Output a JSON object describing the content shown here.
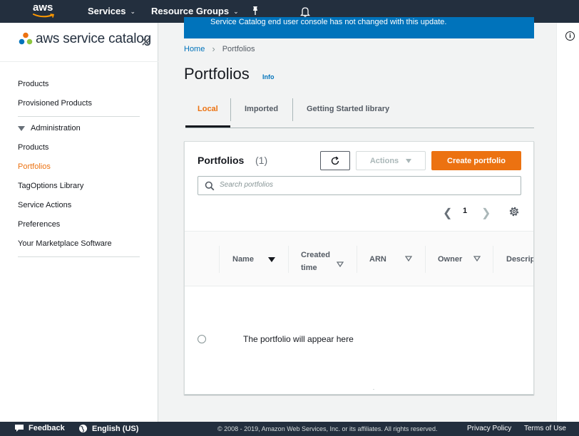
{
  "topnav": {
    "logo_text": "aws",
    "services_label": "Services",
    "resource_groups_label": "Resource Groups"
  },
  "banner": {
    "text": "Service Catalog end user console has not changed with this update."
  },
  "sidebar": {
    "brand": "aws service catalog",
    "items_top": [
      {
        "label": "Products"
      },
      {
        "label": "Provisioned Products"
      }
    ],
    "admin_label": "Administration",
    "items_admin": [
      {
        "label": "Products",
        "active": false
      },
      {
        "label": "Portfolios",
        "active": true
      },
      {
        "label": "TagOptions Library",
        "active": false
      },
      {
        "label": "Service Actions",
        "active": false
      },
      {
        "label": "Preferences",
        "active": false
      },
      {
        "label": "Your Marketplace Software",
        "active": false
      }
    ]
  },
  "breadcrumb": {
    "home": "Home",
    "current": "Portfolios"
  },
  "page": {
    "title": "Portfolios",
    "info_link": "Info"
  },
  "tabs": [
    {
      "label": "Local",
      "active": true
    },
    {
      "label": "Imported",
      "active": false
    },
    {
      "label": "Getting Started library",
      "active": false
    }
  ],
  "card": {
    "title": "Portfolios",
    "count": "(1)",
    "actions_label": "Actions",
    "create_label": "Create portfolio",
    "search_placeholder": "Search portfolios",
    "page_number": "1",
    "columns": [
      "Name",
      "Created time",
      "ARN",
      "Owner",
      "Descrip"
    ],
    "empty_message": "The portfolio will appear here"
  },
  "footer": {
    "feedback": "Feedback",
    "language": "English (US)",
    "copyright": "© 2008 - 2019, Amazon Web Services, Inc. or its affiliates. All rights reserved.",
    "privacy": "Privacy Policy",
    "terms": "Terms of Use"
  },
  "colors": {
    "nav_bg": "#232f3e",
    "accent_orange": "#ec7211",
    "link_blue": "#0073bb",
    "banner_blue": "#0073bb"
  }
}
